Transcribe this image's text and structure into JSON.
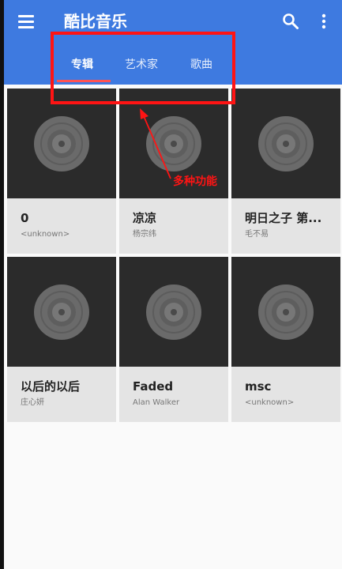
{
  "app": {
    "title": "酷比音乐",
    "accent_color": "#3e7ae0",
    "tab_indicator_color": "#ff5252"
  },
  "toolbar": {
    "menu_icon": "hamburger-menu-icon",
    "search_icon": "search-icon",
    "more_icon": "more-vertical-icon"
  },
  "tabs": [
    {
      "label": "专辑",
      "active": true
    },
    {
      "label": "艺术家",
      "active": false
    },
    {
      "label": "歌曲",
      "active": false
    }
  ],
  "albums": [
    {
      "title": "0",
      "artist": "<unknown>"
    },
    {
      "title": "凉凉",
      "artist": "杨宗纬"
    },
    {
      "title": "明日之子 第...",
      "artist": "毛不易"
    },
    {
      "title": "以后的以后",
      "artist": "庄心妍"
    },
    {
      "title": "Faded",
      "artist": "Alan Walker"
    },
    {
      "title": "msc",
      "artist": "<unknown>"
    }
  ],
  "annotation": {
    "label": "多种功能",
    "color": "#ff1414"
  }
}
